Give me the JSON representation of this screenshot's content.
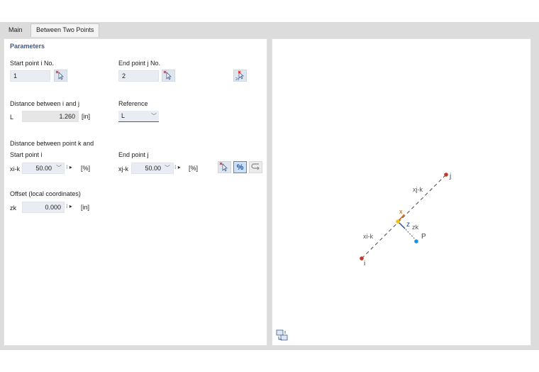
{
  "tabs": {
    "main": "Main",
    "between": "Between Two Points"
  },
  "params": {
    "title": "Parameters",
    "start_label": "Start point i No.",
    "start_value": "1",
    "end_label": "End point j No.",
    "end_value": "2",
    "distance_label": "Distance between i and j",
    "L_symbol": "L",
    "L_value": "1.260",
    "L_unit": "[in]",
    "reference_label": "Reference",
    "reference_value": "L",
    "dist_k_label": "Distance between point k and",
    "start_i_label": "Start point i",
    "end_j_label": "End point j",
    "xik_symbol": "xi-k",
    "xik_value": "50.00",
    "xik_unit": "[%]",
    "xjk_symbol": "xj-k",
    "xjk_value": "50.00",
    "xjk_unit": "[%]",
    "percent_label": "%",
    "offset_label": "Offset (local coordinates)",
    "zk_symbol": "zk",
    "zk_value": "0.000",
    "zk_unit": "[in]"
  },
  "diagram": {
    "label_j": "j",
    "label_i": "i",
    "label_xjk": "xj-k",
    "label_xik": "xi-k",
    "label_x": "x",
    "label_z": "z",
    "label_zk": "zk",
    "label_P": "P"
  },
  "icons": {
    "pick": "pick-node-icon",
    "pick_multi": "pick-multiple-icon",
    "undo": "return-icon",
    "bottom": "view-options-icon"
  },
  "colors": {
    "accent": "#3c5a8c",
    "point": "#c0392b",
    "origin": "#f1c40f",
    "x_axis": "#d35400",
    "z_axis": "#1f4fa0",
    "P_point": "#1e90d6"
  }
}
